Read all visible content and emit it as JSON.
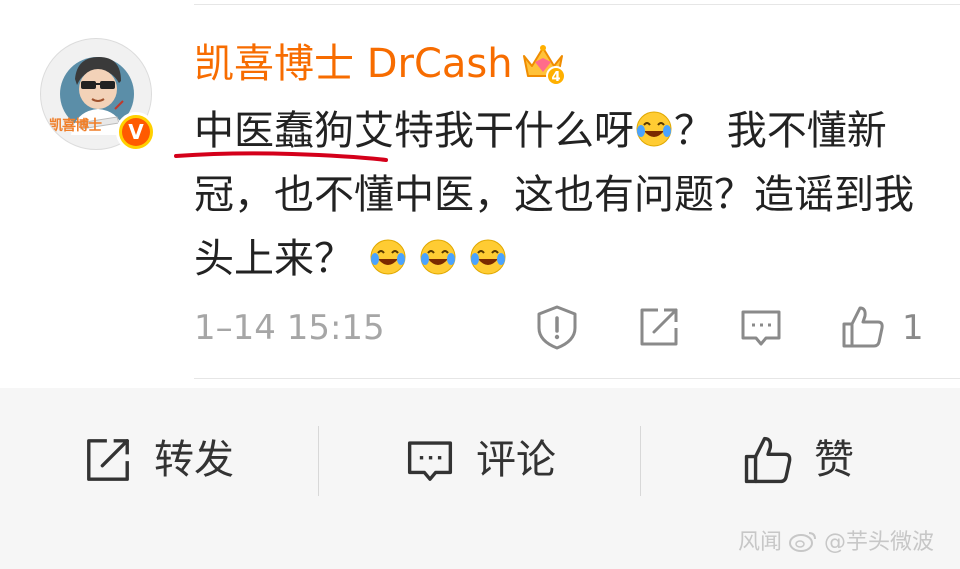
{
  "user": {
    "name": "凯喜博士 DrCash",
    "avatar_label": "凯喜博士",
    "verified_badge": "V",
    "crown_level": "4"
  },
  "comment": {
    "part1": "中医蠢狗艾特我干什么呀",
    "part2": "？ 我不懂新冠，也不懂中医，这也有问题？造谣到我头上来？"
  },
  "meta": {
    "timestamp": "1–14 15:15",
    "like_count": "1"
  },
  "actions": {
    "forward_label": "转发",
    "comment_label": "评论",
    "like_label": "赞"
  },
  "watermark": {
    "text": "@芋头微波",
    "faded_text": "风闻"
  },
  "colors": {
    "username": "#f76c00",
    "underline": "#d4001a",
    "badge_outer": "#ffd000",
    "badge_inner": "#ff5a00"
  },
  "icons": {
    "report": "exclamation-shield-icon",
    "share": "share-out-icon",
    "reply": "comment-bubble-icon",
    "like": "thumbs-up-icon",
    "emoji": "laugh-cry-emoji"
  }
}
